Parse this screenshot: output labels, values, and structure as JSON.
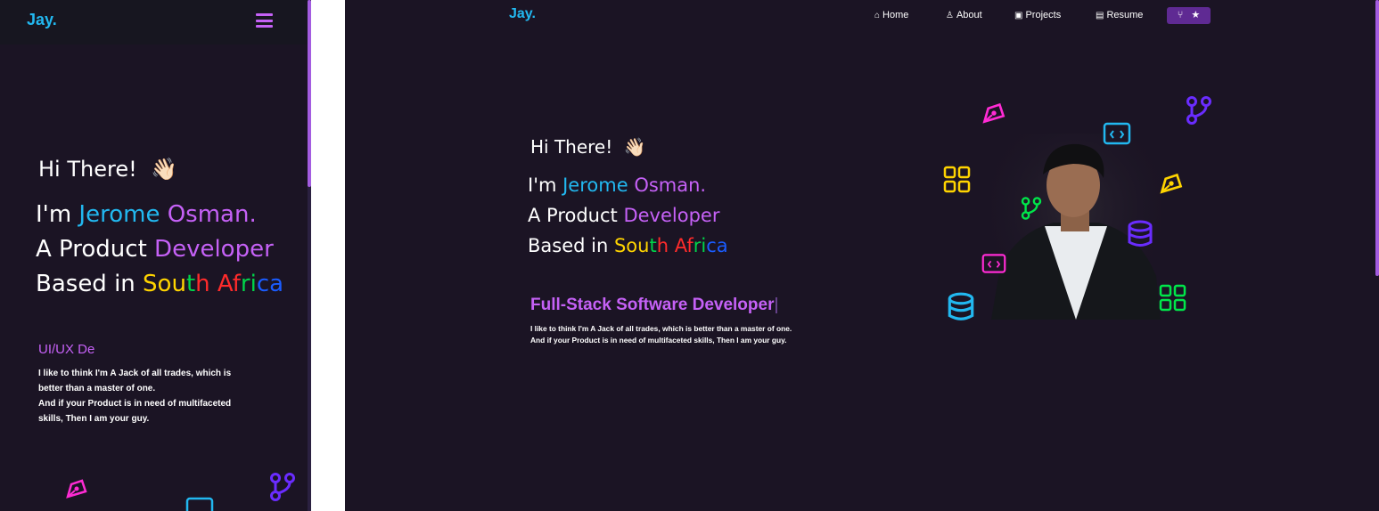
{
  "brand": {
    "logo": "Jay."
  },
  "hero": {
    "greeting": "Hi There!",
    "wave_emoji": "👋🏻",
    "intro_prefix": "I'm ",
    "name_first": "Jerome",
    "name_last": "Osman.",
    "line2_prefix": "A Product ",
    "line2_highlight": "Developer",
    "line3_prefix": "Based in ",
    "country_parts": [
      "So",
      "u",
      "t",
      "h",
      " ",
      "Af",
      "ri",
      "ca"
    ]
  },
  "mobile": {
    "typed_text": "UI/UX De",
    "description": [
      "I like to think I'm A Jack of all trades, which is",
      "better than a master of one.",
      "And if your Product is in need of multifaceted",
      "skills, Then I am your guy."
    ]
  },
  "desktop": {
    "nav": [
      {
        "icon": "⌂",
        "label": "Home"
      },
      {
        "icon": "♙",
        "label": "About"
      },
      {
        "icon": "▣",
        "label": "Projects"
      },
      {
        "icon": "▤",
        "label": "Resume"
      }
    ],
    "github_button": {
      "icon": "⑂",
      "star": "★"
    },
    "typed_text": "Full-Stack Software Developer",
    "description": [
      "I like to think I'm A Jack of all trades, which is better than a master of one.",
      "And if your Product is in need of multifaceted skills, Then I am your guy."
    ]
  },
  "colors": {
    "background": "#1b1424",
    "accent_purple": "#c561f6",
    "accent_blue": "#22b8f0"
  },
  "icons": [
    "pen-nib-icon",
    "git-branch-icon",
    "code-window-icon",
    "grid-icon",
    "database-icon"
  ]
}
